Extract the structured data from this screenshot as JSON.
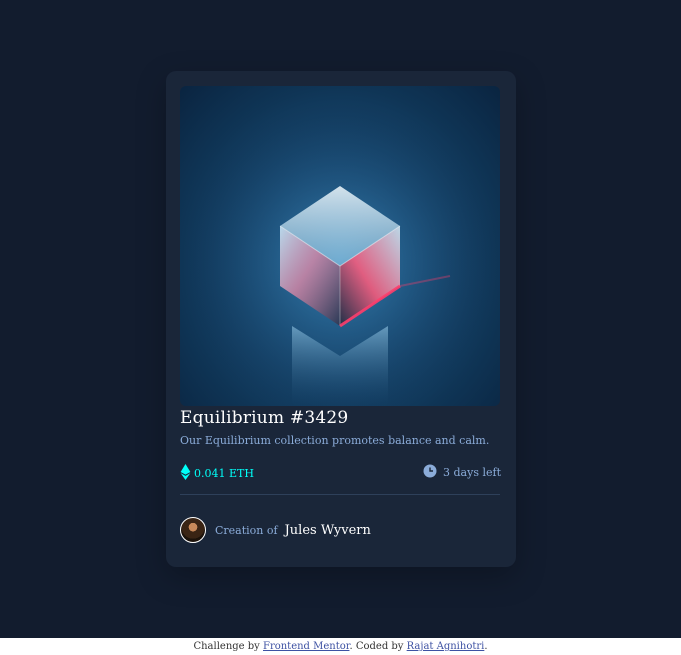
{
  "card": {
    "title": "Equilibrium #3429",
    "description": "Our Equilibrium collection promotes balance and calm.",
    "price": "0.041 ETH",
    "time_left": "3 days left",
    "creation_of_label": "Creation of",
    "creator_name": "Jules Wyvern"
  },
  "icons": {
    "price": "ethereum-icon",
    "time": "clock-icon",
    "avatar": "avatar"
  },
  "footer": {
    "prefix": "Challenge by",
    "challenge_link": "Frontend Mentor",
    "middle": ". Coded by",
    "author_link": "Rajat Agnihotri",
    "suffix": "."
  },
  "colors": {
    "page_bg": "#121c2e",
    "card_bg": "#1a2639",
    "accent_cyan": "#00fff8",
    "soft_blue": "#8bacd9",
    "white": "#ffffff"
  }
}
